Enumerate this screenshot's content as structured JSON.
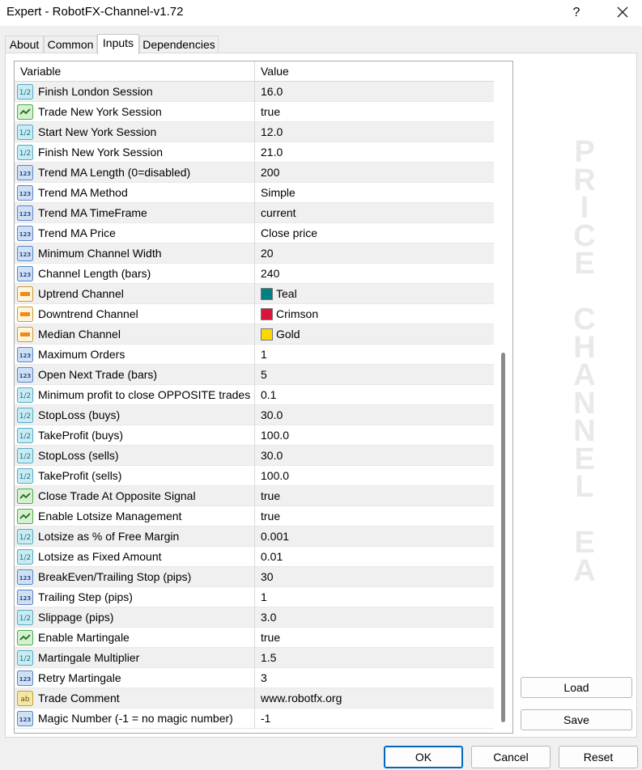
{
  "window": {
    "title": "Expert - RobotFX-Channel-v1.72",
    "help_label": "?"
  },
  "tabs": [
    {
      "label": "About"
    },
    {
      "label": "Common"
    },
    {
      "label": "Inputs"
    },
    {
      "label": "Dependencies"
    }
  ],
  "active_tab": "Inputs",
  "grid": {
    "col_variable": "Variable",
    "col_value": "Value",
    "rows": [
      {
        "type": "double",
        "label": "Finish London Session",
        "value": "16.0"
      },
      {
        "type": "bool",
        "label": "Trade New York Session",
        "value": "true"
      },
      {
        "type": "double",
        "label": "Start New York Session",
        "value": "12.0"
      },
      {
        "type": "double",
        "label": "Finish New York Session",
        "value": "21.0"
      },
      {
        "type": "int",
        "label": "Trend MA Length (0=disabled)",
        "value": "200"
      },
      {
        "type": "int",
        "label": "Trend MA Method",
        "value": "Simple"
      },
      {
        "type": "int",
        "label": "Trend MA TimeFrame",
        "value": "current"
      },
      {
        "type": "int",
        "label": "Trend MA Price",
        "value": "Close price"
      },
      {
        "type": "int",
        "label": "Minimum Channel Width",
        "value": "20"
      },
      {
        "type": "int",
        "label": "Channel Length (bars)",
        "value": "240"
      },
      {
        "type": "color",
        "label": "Uptrend Channel",
        "value": "Teal",
        "color": "#008080"
      },
      {
        "type": "color",
        "label": "Downtrend Channel",
        "value": "Crimson",
        "color": "#dc143c"
      },
      {
        "type": "color",
        "label": "Median Channel",
        "value": "Gold",
        "color": "#ffd700"
      },
      {
        "type": "int",
        "label": "Maximum Orders",
        "value": "1"
      },
      {
        "type": "int",
        "label": "Open Next Trade (bars)",
        "value": "5"
      },
      {
        "type": "double",
        "label": "Minimum profit to close OPPOSITE trades",
        "value": "0.1"
      },
      {
        "type": "double",
        "label": "StopLoss (buys)",
        "value": "30.0"
      },
      {
        "type": "double",
        "label": "TakeProfit (buys)",
        "value": "100.0"
      },
      {
        "type": "double",
        "label": "StopLoss (sells)",
        "value": "30.0"
      },
      {
        "type": "double",
        "label": "TakeProfit (sells)",
        "value": "100.0"
      },
      {
        "type": "bool",
        "label": "Close Trade At Opposite Signal",
        "value": "true"
      },
      {
        "type": "bool",
        "label": "Enable Lotsize Management",
        "value": "true"
      },
      {
        "type": "double",
        "label": "Lotsize as % of Free Margin",
        "value": "0.001"
      },
      {
        "type": "double",
        "label": "Lotsize as Fixed Amount",
        "value": "0.01"
      },
      {
        "type": "int",
        "label": "BreakEven/Trailing Stop (pips)",
        "value": "30"
      },
      {
        "type": "int",
        "label": "Trailing Step (pips)",
        "value": "1"
      },
      {
        "type": "double",
        "label": "Slippage (pips)",
        "value": "3.0"
      },
      {
        "type": "bool",
        "label": "Enable Martingale",
        "value": "true"
      },
      {
        "type": "double",
        "label": "Martingale Multiplier",
        "value": "1.5"
      },
      {
        "type": "int",
        "label": "Retry Martingale",
        "value": "3"
      },
      {
        "type": "string",
        "label": "Trade Comment",
        "value": "www.robotfx.org"
      },
      {
        "type": "int",
        "label": "Magic Number (-1 = no magic number)",
        "value": "-1"
      }
    ]
  },
  "watermark": "PRICE CHANNEL EA",
  "buttons": {
    "load": "Load",
    "save": "Save",
    "ok": "OK",
    "cancel": "Cancel",
    "reset": "Reset"
  }
}
